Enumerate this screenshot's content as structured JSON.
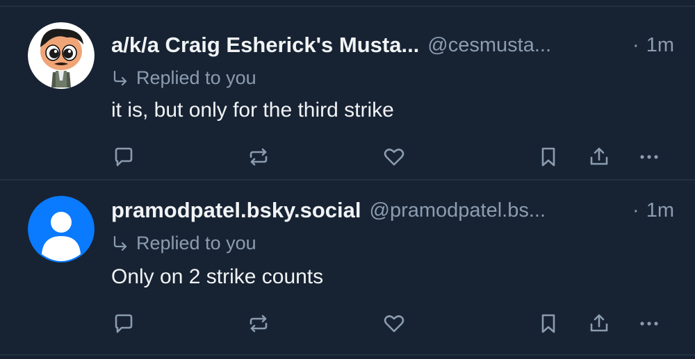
{
  "posts": [
    {
      "author_name": "a/k/a Craig Esherick's Musta...",
      "handle": "@cesmusta...",
      "dot": "·",
      "time": "1m",
      "replied": "Replied to you",
      "text": "it is, but only for the third strike",
      "avatar": "cartoon-avatar"
    },
    {
      "author_name": "pramodpatel.bsky.social",
      "handle": "@pramodpatel.bs...",
      "dot": "·",
      "time": "1m",
      "replied": "Replied to you",
      "text": "Only on 2 strike counts",
      "avatar": "default-user-avatar"
    }
  ],
  "colors": {
    "background": "#172333",
    "divider": "#22303f",
    "muted": "#8c9cb0",
    "text": "#f1f3f5",
    "avatar_blue": "#0a7aff"
  },
  "icons": [
    "reply-icon",
    "repost-icon",
    "like-icon",
    "bookmark-icon",
    "share-icon",
    "more-icon"
  ]
}
